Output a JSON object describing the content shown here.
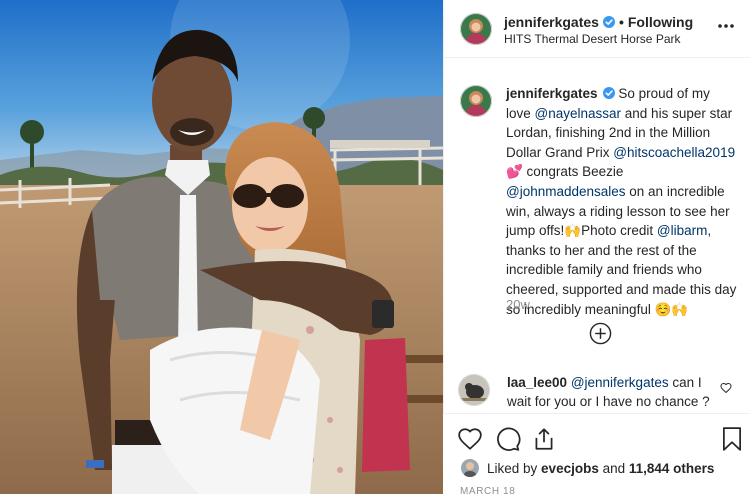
{
  "header": {
    "username": "jenniferkgates",
    "dot": "•",
    "follow_state": "Following",
    "location": "HITS Thermal Desert Horse Park"
  },
  "caption": {
    "username": "jenniferkgates",
    "segments": [
      {
        "text": "So proud of my love ",
        "type": "text"
      },
      {
        "text": "@nayelnassar",
        "type": "mention"
      },
      {
        "text": " and his super star Lordan, finishing 2nd in the Million Dollar Grand Prix ",
        "type": "text"
      },
      {
        "text": "@hitscoachella2019",
        "type": "mention"
      },
      {
        "text": " 💕 congrats Beezie ",
        "type": "text"
      },
      {
        "text": "@johnmaddensales",
        "type": "mention"
      },
      {
        "text": " on an incredible win, always a riding lesson to see her jump offs!🙌Photo credit ",
        "type": "text"
      },
      {
        "text": "@libarm",
        "type": "mention"
      },
      {
        "text": ", thanks to her and the rest of the incredible family and friends who cheered, supported and made this day so incredibly meaningful ☺️🙌",
        "type": "text"
      }
    ],
    "time": "20w"
  },
  "comment": {
    "username": "laa_lee00",
    "mention": "@jenniferkgates",
    "text": " can I wait for you or I have no chance ?"
  },
  "likes": {
    "prefix": "Liked by ",
    "first_user": "evecjobs",
    "middle": " and ",
    "count": "11,844 others"
  },
  "date": "MARCH 18",
  "icons": {
    "more": "more-horizontal-icon",
    "load_more": "plus-circle-icon",
    "like": "heart-icon",
    "comment": "comment-icon",
    "share": "share-icon",
    "save": "bookmark-icon",
    "verified": "verified-badge-icon"
  },
  "colors": {
    "mention": "#003569",
    "verified": "#3897f0",
    "muted": "#8e8e8e",
    "text": "#262626"
  }
}
